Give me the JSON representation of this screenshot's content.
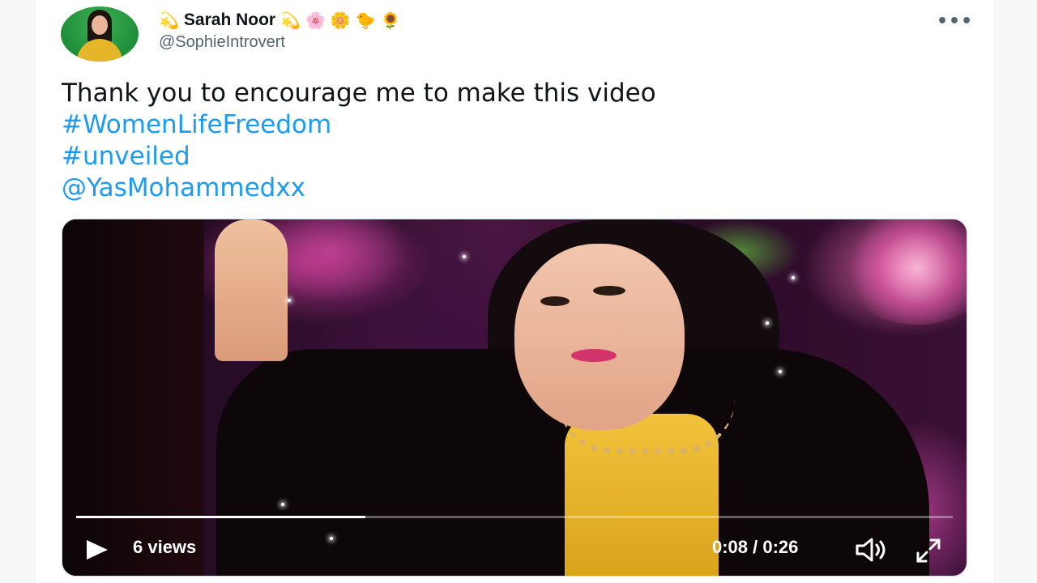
{
  "tweet": {
    "author": {
      "display_name": "Sarah Noor",
      "name_emojis_before": [
        "💫"
      ],
      "name_emojis_after": [
        "💫",
        "🌸",
        "🌼",
        "🐤",
        "🌻"
      ],
      "handle": "@SophieIntrovert"
    },
    "more_label": "•••",
    "text": {
      "line1": "Thank you to encourage me to make this video",
      "hashtag1": "#WomenLifeFreedom",
      "hashtag2": "#unveiled",
      "mention": "@YasMohammedxx"
    },
    "video": {
      "views": "6 views",
      "time": "0:08 / 0:26",
      "progress": 0.33
    }
  },
  "colors": {
    "link": "#1d9bf0",
    "text": "#0f1419",
    "secondary": "#536471"
  },
  "icons": [
    "more-icon",
    "play-icon",
    "volume-icon",
    "fullscreen-icon"
  ]
}
